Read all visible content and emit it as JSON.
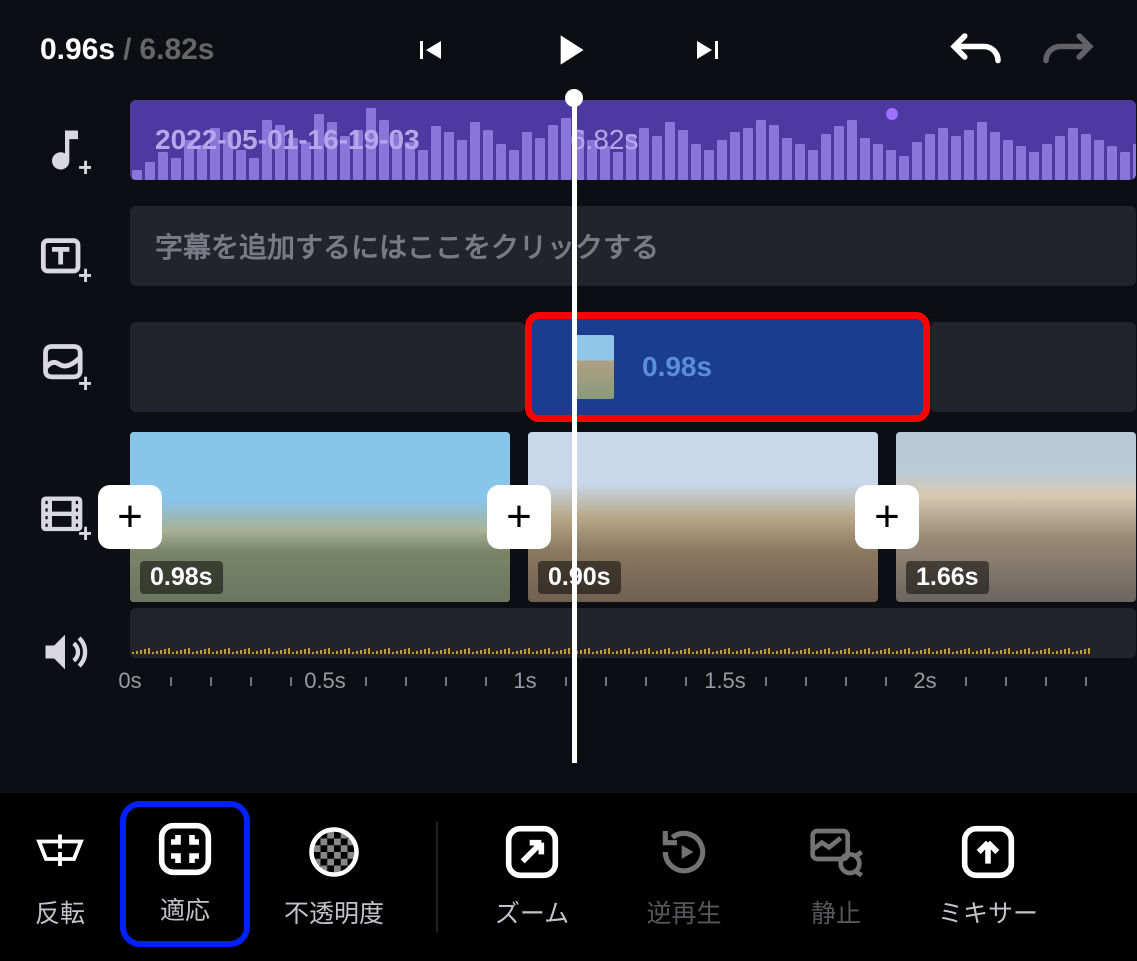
{
  "time": {
    "current": "0.96s",
    "total": "6.82s"
  },
  "audio": {
    "filename": "2022-05-01-16-19-03",
    "duration": "6.82s"
  },
  "subtitle": {
    "placeholder": "字幕を追加するにはここをクリックする"
  },
  "pip": {
    "duration": "0.98s"
  },
  "videoClips": [
    {
      "duration": "0.98s"
    },
    {
      "duration": "0.90s"
    },
    {
      "duration": "1.66s"
    }
  ],
  "ruler": [
    {
      "label": "0s"
    },
    {
      "label": "0.5s"
    },
    {
      "label": "1s"
    },
    {
      "label": "1.5s"
    },
    {
      "label": "2s"
    }
  ],
  "toolbar": {
    "flip": "反転",
    "fit": "適応",
    "opacity": "不透明度",
    "zoom": "ズーム",
    "reverse": "逆再生",
    "freeze": "静止",
    "mixer": "ミキサー"
  }
}
